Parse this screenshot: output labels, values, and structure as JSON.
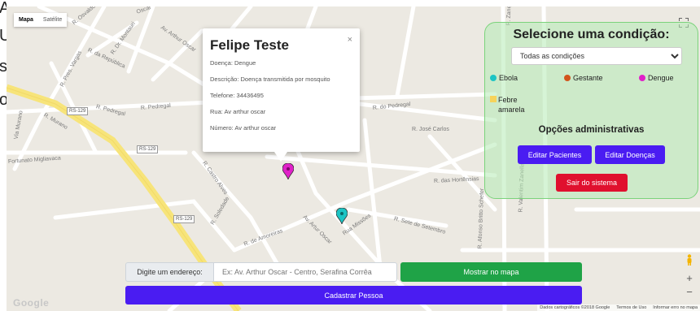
{
  "side_letters": [
    "A",
    "U",
    "s",
    "o"
  ],
  "map": {
    "type_control": {
      "map": "Mapa",
      "satellite": "Satélite"
    },
    "road_labels": [
      "R. Osvaldo",
      "Oscar",
      "Av. Arthur Oscar",
      "R. da República",
      "R. Dr. Montauri",
      "R. Pres. Vargas",
      "R. Pedregal",
      "R. Pedregal",
      "R. do Pedregal",
      "R. José Carlos",
      "Via Murano",
      "R. Murano",
      "Fortunato Migliavaca",
      "R. Castro Alves",
      "R. das Hortênsias",
      "R. Soledade",
      "R. de Amoreiras",
      "Av. Artur Oscar",
      "Rua Missões",
      "R. Sete de Setembro",
      "R. Afonso Britto Schefer",
      "R. Valentim Zanella",
      "R. Zanella"
    ],
    "highway_badges": [
      "RS-129",
      "RS-129",
      "RS-129"
    ],
    "google_logo": "Google",
    "attribution": [
      "Dados cartográficos ©2018 Google",
      "Termos de Uso",
      "Informar erro no mapa"
    ],
    "zoom_in": "+",
    "zoom_out": "−"
  },
  "info_window": {
    "name": "Felipe Teste",
    "close": "×",
    "disease": "Doença: Dengue",
    "description": "Descrição: Doença transmitida por mosquito",
    "phone": "Telefone: 34436495",
    "street": "Rua: Av arthur oscar",
    "number": "Número: Av arthur oscar"
  },
  "markers": [
    {
      "condition": "Dengue",
      "color": "#e020c8"
    },
    {
      "condition": "Ebola",
      "color": "#1cc4c4"
    }
  ],
  "condition_panel": {
    "title": "Selecione uma condição:",
    "select_value": "Todas as condições",
    "legend": [
      {
        "label": "Ebola",
        "color": "#1cc4c4"
      },
      {
        "label": "Gestante",
        "color": "#d2541c"
      },
      {
        "label": "Dengue",
        "color": "#e020c8"
      },
      {
        "label": "Febre amarela",
        "color": "#f6d35a"
      }
    ],
    "admin_title": "Opções administrativas",
    "edit_patients": "Editar Pacientes",
    "edit_diseases": "Editar Doenças",
    "logout": "Sair do sistema"
  },
  "address": {
    "label": "Digite um endereço:",
    "placeholder": "Ex: Av. Arthur Oscar - Centro, Serafina Corrêa",
    "show_button": "Mostrar no mapa",
    "register_button": "Cadastrar Pessoa"
  },
  "colors": {
    "primary": "#4a1cf2",
    "success": "#1fa347",
    "danger": "#e0102e",
    "panel_border": "#7bd37b"
  }
}
